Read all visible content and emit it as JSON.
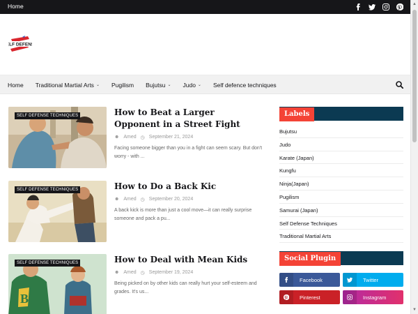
{
  "topbar": {
    "home_label": "Home",
    "social_icons": [
      "facebook-icon",
      "twitter-icon",
      "instagram-icon",
      "pinterest-icon"
    ]
  },
  "nav": {
    "items": [
      {
        "label": "Home",
        "has_dropdown": false
      },
      {
        "label": "Traditional Martial Arts",
        "has_dropdown": true
      },
      {
        "label": "Pugilism",
        "has_dropdown": false
      },
      {
        "label": "Bujutsu",
        "has_dropdown": true
      },
      {
        "label": "Judo",
        "has_dropdown": true
      },
      {
        "label": "Self defence techniques",
        "has_dropdown": false
      }
    ],
    "search_icon": "search-icon"
  },
  "posts": [
    {
      "tag": "SELF DEFENSE TECHNIQUES",
      "title": "How to Beat a Larger Opponent in a Street Fight",
      "author": "Amed",
      "date": "September 21, 2024",
      "excerpt": "Facing someone bigger than you in a fight can seem scary. But don't worry - with ..."
    },
    {
      "tag": "SELF DEFENSE TECHNIQUES",
      "title": "How to Do a Back Kic",
      "author": "Amed",
      "date": "September 20, 2024",
      "excerpt": "A back kick is more than just a cool move—it can really surprise someone and pack a pu..."
    },
    {
      "tag": "SELF DEFENSE TECHNIQUES",
      "title": "How to Deal with Mean Kids",
      "author": "Amed",
      "date": "September 19, 2024",
      "excerpt": "Being picked on by other kids can really hurt your self-esteem and grades. It's us..."
    }
  ],
  "sidebar": {
    "labels_title": "Labels",
    "labels": [
      "Bujutsu",
      "Judo",
      "Karate (Japan)",
      "Kungfu",
      "Ninja(Japan)",
      "Pugilism",
      "Samurai (Japan)",
      "Self Defense Techniques",
      "Traditional Martial Arts"
    ],
    "social_title": "Social Plugin",
    "social_buttons": [
      {
        "label": "Facebook",
        "color": "#3b5999",
        "icon": "facebook-icon"
      },
      {
        "label": "Twitter",
        "color": "#00acee",
        "icon": "twitter-icon"
      },
      {
        "label": "Pinterest",
        "color": "#ca2127",
        "icon": "pinterest-icon"
      },
      {
        "label": "Instagram",
        "color": "#d6249f",
        "icon": "instagram-icon"
      }
    ]
  },
  "colors": {
    "topbar": "#161619",
    "accent": "#f44336",
    "widget_bar": "#0b3a52"
  }
}
